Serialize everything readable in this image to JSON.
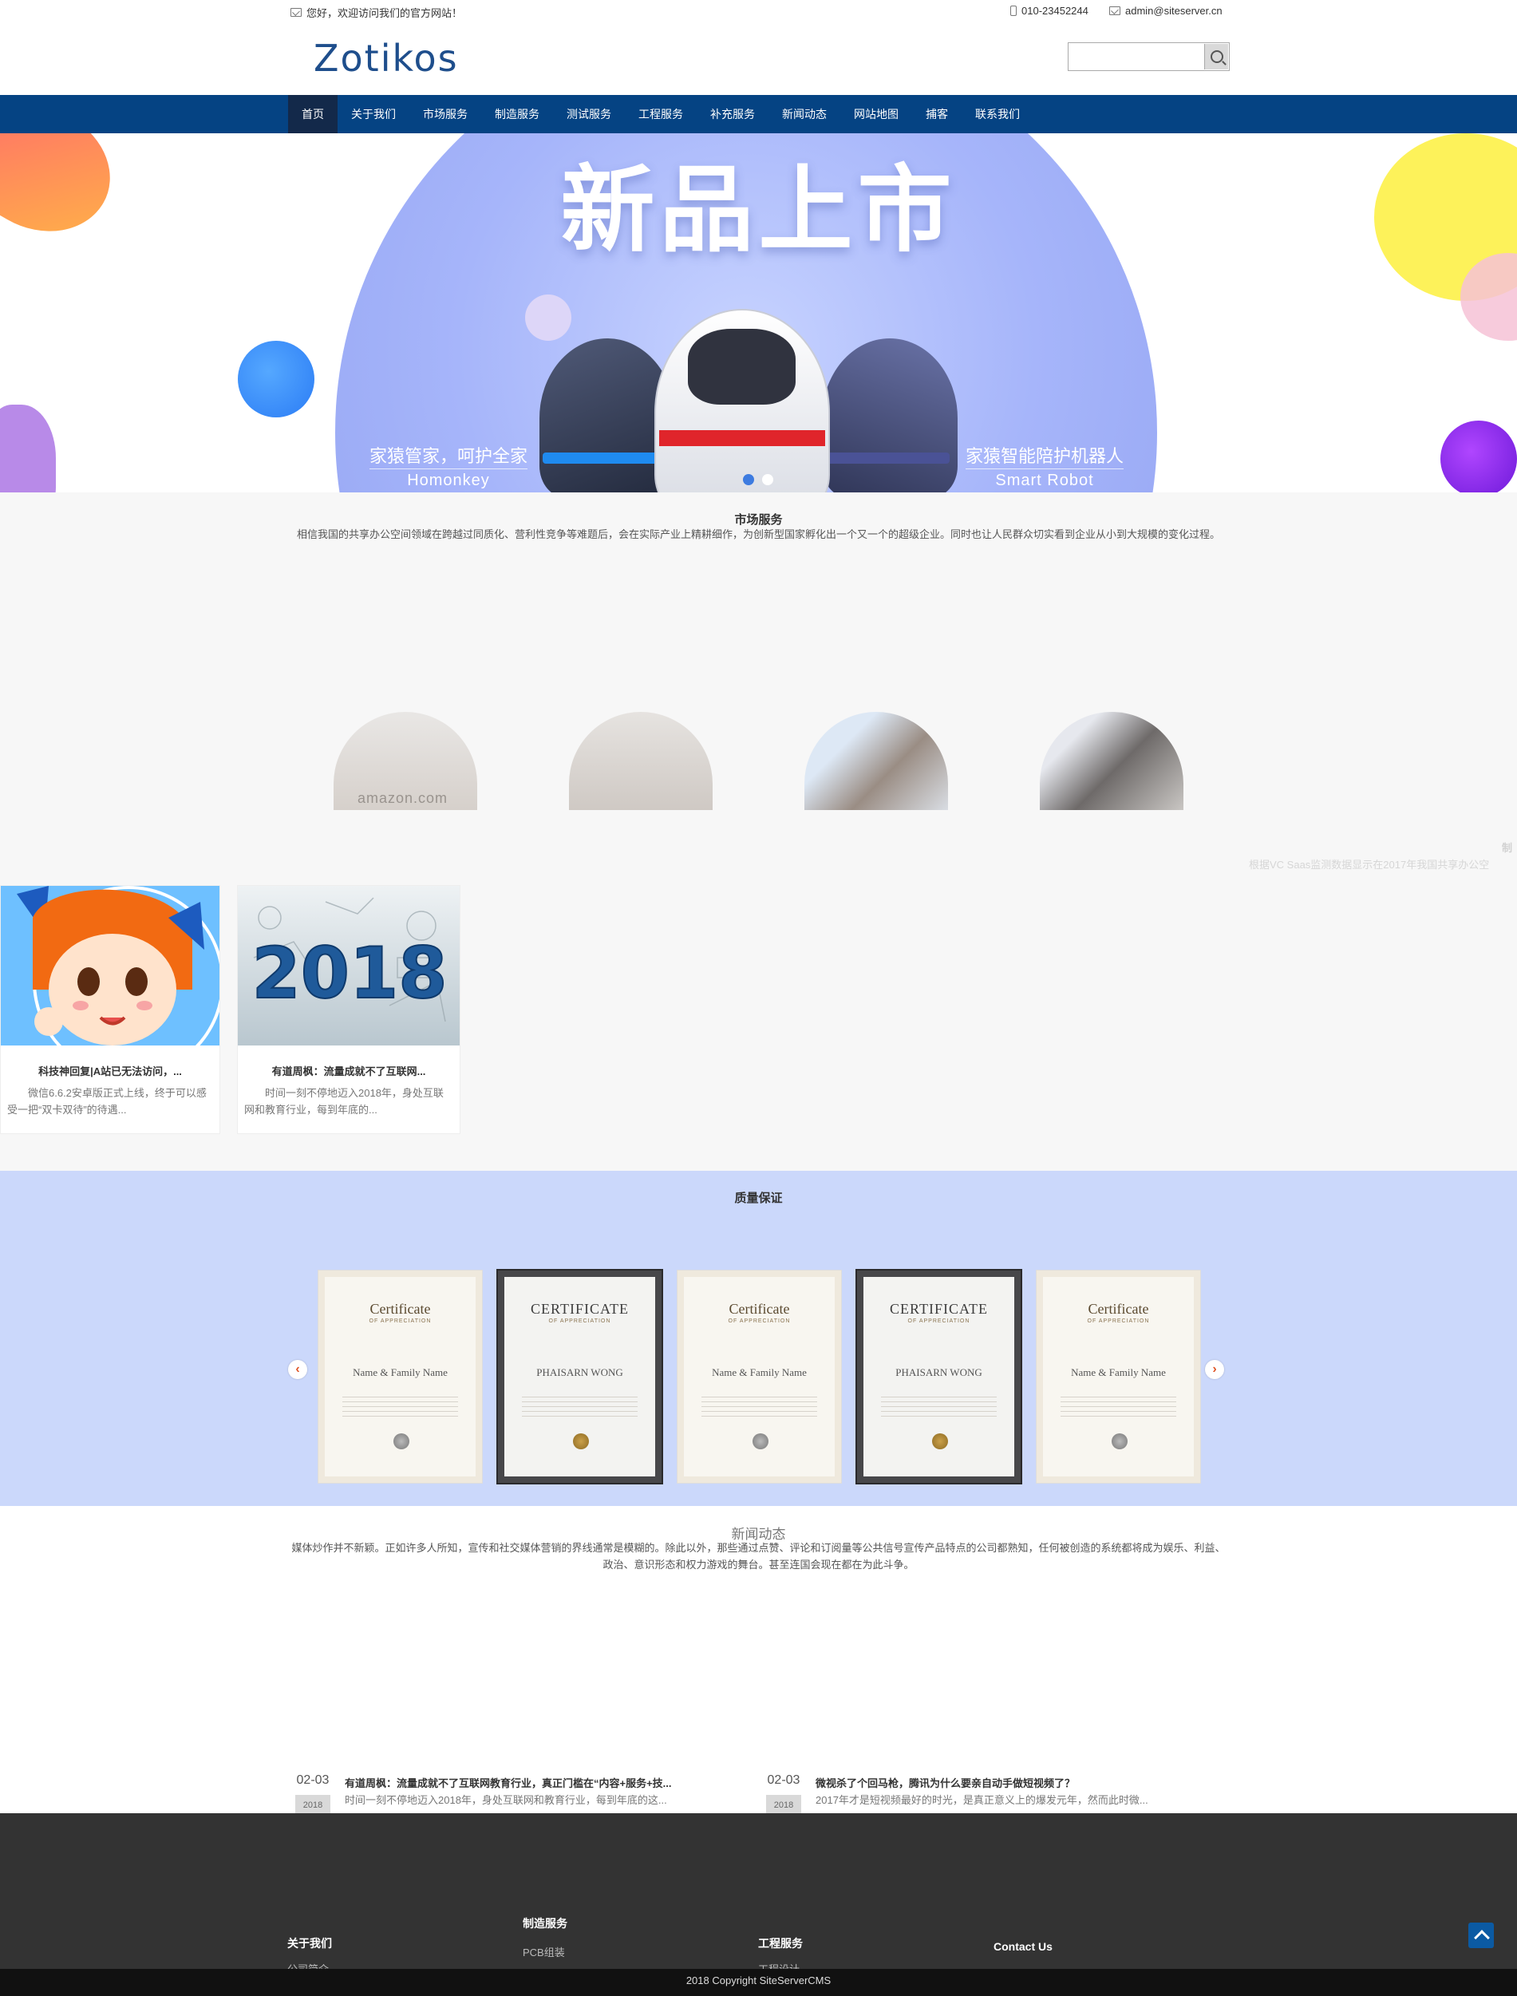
{
  "topbar": {
    "welcome": "您好，欢迎访问我们的官方网站！",
    "phone": "010-23452244",
    "email": "admin@siteserver.cn"
  },
  "header": {
    "logo": "Zotikos",
    "search_placeholder": ""
  },
  "nav": {
    "items": [
      "首页",
      "关于我们",
      "市场服务",
      "制造服务",
      "测试服务",
      "工程服务",
      "补充服务",
      "新闻动态",
      "网站地图",
      "捕客",
      "联系我们"
    ],
    "active_index": 0
  },
  "banner": {
    "headline": "新品上市",
    "left_caption_cn": "家猿管家，呵护全家",
    "left_caption_en": "Homonkey",
    "right_caption_cn": "家猿智能陪护机器人",
    "right_caption_en": "Smart Robot",
    "slide_count": 2,
    "active_slide": 0
  },
  "market": {
    "title": "市场服务",
    "description": "相信我国的共享办公空间领域在跨越过同质化、营利性竞争等难题后，会在实际产业上精耕细作，为创新型国家孵化出一个又一个的超级企业。同时也让人民群众切实看到企业从小到大规模的变化过程。",
    "circle_watermark": "amazon.com",
    "side_ghost_title": "制",
    "side_ghost_desc": "根据VC Saas监测数据显示在2017年我国共享办公空",
    "cards": [
      {
        "title": "科技神回复|A站已无法访问，...",
        "desc": "微信6.6.2安卓版正式上线，终于可以感受一把“双卡双待”的待遇..."
      },
      {
        "title": "有道周枫：流量成就不了互联网...",
        "desc": "时间一刻不停地迈入2018年，身处互联网和教育行业，每到年底的..."
      }
    ],
    "card_2_badge": "2018"
  },
  "quality": {
    "title": "质量保证",
    "certificates": [
      {
        "style": "light",
        "heading": "Certificate",
        "sub": "OF APPRECIATION",
        "name": "Name & Family Name"
      },
      {
        "style": "dark",
        "heading": "CERTIFICATE",
        "sub": "OF APPRECIATION",
        "name": "PHAISARN WONG"
      },
      {
        "style": "light",
        "heading": "Certificate",
        "sub": "OF APPRECIATION",
        "name": "Name & Family Name"
      },
      {
        "style": "dark",
        "heading": "CERTIFICATE",
        "sub": "OF APPRECIATION",
        "name": "PHAISARN WONG"
      },
      {
        "style": "light",
        "heading": "Certificate",
        "sub": "OF APPRECIATION",
        "name": "Name & Family Name"
      }
    ],
    "arrow_left_icon": "chevron-left-icon",
    "arrow_right_icon": "chevron-right-icon"
  },
  "news": {
    "title": "新闻动态",
    "description": "媒体炒作并不新颖。正如许多人所知，宣传和社交媒体营销的界线通常是模糊的。除此以外，那些通过点赞、评论和订阅量等公共信号宣传产品特点的公司都熟知，任何被创造的系统都将成为娱乐、利益、政治、意识形态和权力游戏的舞台。甚至连国会现在都在为此斗争。",
    "items": [
      {
        "date": "02-03",
        "year": "2018",
        "title": "有道周枫：流量成就不了互联网教育行业，真正门槛在“内容+服务+技...",
        "summary": "时间一刻不停地迈入2018年，身处互联网和教育行业，每到年底的这..."
      },
      {
        "date": "02-03",
        "year": "2018",
        "title": "微视杀了个回马枪，腾讯为什么要亲自动手做短视频了？",
        "summary": "2017年才是短视频最好的时光，是真正意义上的爆发元年，然而此时微..."
      }
    ]
  },
  "footer": {
    "col_about": "关于我们",
    "col_about_link": "公司简介",
    "col_make": "制造服务",
    "col_make_link": "PCB组装",
    "col_eng": "工程服务",
    "col_eng_link": "工程设计",
    "col_contact": "Contact Us",
    "copyright": "2018 Copyright SiteServerCMS",
    "back_to_top_icon": "chevron-up-icon"
  },
  "colors": {
    "nav_bg": "#054383",
    "nav_active": "#13294a",
    "quality_bg": "#cbd8fb",
    "footer_bg": "#333333",
    "accent_arrow": "#e05526"
  }
}
